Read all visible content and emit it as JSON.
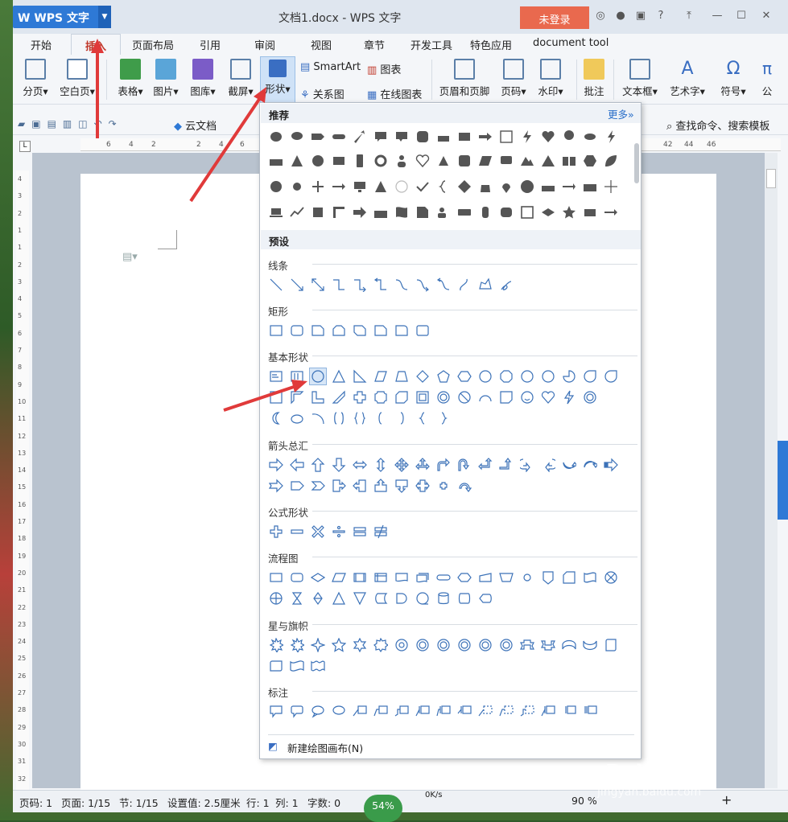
{
  "app": {
    "title": "文档1.docx - WPS 文字",
    "brand": "WPS 文字",
    "login": "未登录"
  },
  "menu": [
    "开始",
    "插入",
    "页面布局",
    "引用",
    "审阅",
    "视图",
    "章节",
    "开发工具",
    "特色应用",
    "document tool"
  ],
  "ribbon": {
    "paging": "分页",
    "blank": "空白页",
    "table": "表格",
    "picture": "图片",
    "gallery": "图库",
    "screenshot": "截屏",
    "shape": "形状",
    "smartart": "SmartArt",
    "chart": "图表",
    "relation": "关系图",
    "online_chart": "在线图表",
    "header_footer": "页眉和页脚",
    "page_num": "页码",
    "watermark": "水印",
    "comment": "批注",
    "textbox": "文本框",
    "wordart": "艺术字",
    "symbol": "符号",
    "formula": "公"
  },
  "qat": {
    "cloud": "云文档",
    "search": "查找命令、搜索模板"
  },
  "ruler_top": [
    "6",
    "4",
    "2",
    "2",
    "4",
    "6",
    "42",
    "44",
    "46"
  ],
  "ruler_left": [
    "4",
    "3",
    "2",
    "1",
    "1",
    "2",
    "3",
    "4",
    "5",
    "6",
    "7",
    "8",
    "9",
    "10",
    "11",
    "12",
    "13",
    "14",
    "15",
    "16",
    "17",
    "18",
    "19",
    "20",
    "21",
    "22",
    "23",
    "24",
    "25",
    "26",
    "27",
    "28",
    "29",
    "30",
    "31",
    "32"
  ],
  "dropdown": {
    "recommended": "推荐",
    "more": "更多»",
    "preset": "预设",
    "categories": [
      "线条",
      "矩形",
      "基本形状",
      "箭头总汇",
      "公式形状",
      "流程图",
      "星与旗帜",
      "标注"
    ],
    "new_canvas": "新建绘图画布(N)"
  },
  "status": {
    "page": "页码: 1",
    "pages": "页面: 1/15",
    "section": "节: 1/15",
    "setting": "设置值: 2.5厘米",
    "row": "行: 1",
    "col": "列: 1",
    "words": "字数: 0",
    "zoom": "90 %",
    "cpu": "54%",
    "net": "0K/s"
  },
  "watermark": "Baidu经验",
  "watermark_sub": "jingyan.baidu.com"
}
